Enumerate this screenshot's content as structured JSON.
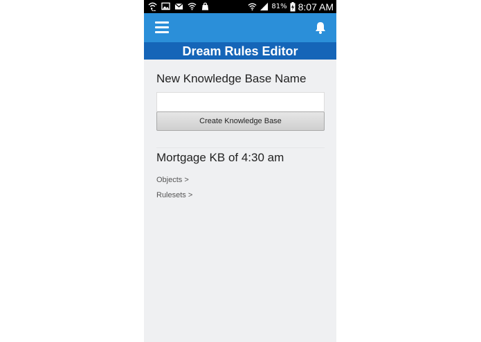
{
  "status_bar": {
    "battery_percent": "81%",
    "time": "8:07 AM",
    "left_icons": [
      "wifi-call-icon",
      "image-icon",
      "gmail-icon",
      "wifi-icon",
      "shopping-bag-icon"
    ],
    "right_icons": [
      "wifi-signal-icon",
      "cell-signal-icon",
      "battery-charging-icon"
    ]
  },
  "app_bar": {
    "menu_icon": "hamburger-menu-icon",
    "notification_icon": "bell-icon",
    "color": "#2b8fd9"
  },
  "page": {
    "title": "Dream Rules Editor",
    "title_bar_color": "#1565b8"
  },
  "form": {
    "label": "New Knowledge Base Name",
    "input_value": "",
    "input_placeholder": "",
    "button_label": "Create Knowledge Base"
  },
  "knowledge_base": {
    "title": "Mortgage KB of 4:30 am",
    "links": [
      {
        "label": "Objects >"
      },
      {
        "label": "Rulesets >"
      }
    ]
  }
}
